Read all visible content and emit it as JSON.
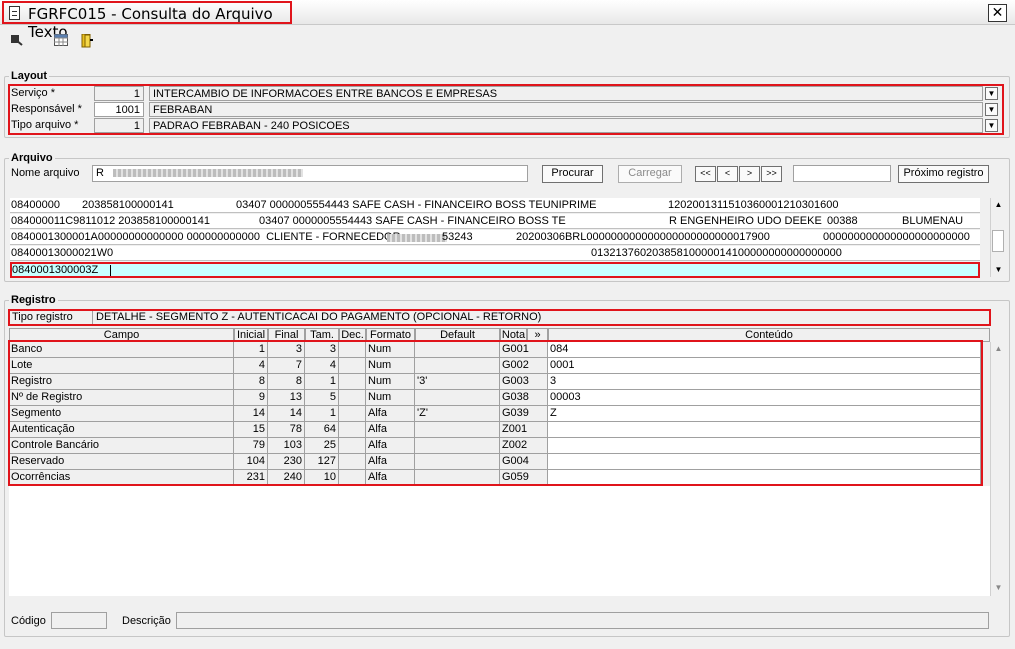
{
  "window": {
    "title": "FGRFC015 - Consulta do Arquivo Texto",
    "close_label": "✕"
  },
  "layout": {
    "title": "Layout",
    "servico": {
      "label": "Serviço *",
      "code": "1",
      "value": "INTERCAMBIO DE INFORMACOES ENTRE BANCOS E EMPRESAS"
    },
    "responsavel": {
      "label": "Responsável *",
      "code": "1001",
      "value": "FEBRABAN"
    },
    "tipo_arquivo": {
      "label": "Tipo arquivo *",
      "code": "1",
      "value": "PADRAO FEBRABAN - 240 POSICOES"
    }
  },
  "arquivo": {
    "title": "Arquivo",
    "nome_label": "Nome arquivo",
    "nome_value": "R",
    "buttons": {
      "procurar": "Procurar",
      "carregar": "Carregar",
      "first": "<<",
      "prev": "<",
      "next": ">",
      "last": ">>",
      "proximo": "Próximo registro"
    },
    "search_value": "",
    "lines": [
      [
        "08400000",
        "203858100000141",
        "03407 0000005554443 SAFE CASH - FINANCEIRO BOSS TEUNIPRIME",
        "1202001311510360001210301600"
      ],
      [
        "084000011C9811012 203858100000141",
        "03407 0000005554443 SAFE CASH - FINANCEIRO BOSS TE",
        "R ENGENHEIRO UDO DEEKE",
        "00388",
        "BLUMENAU"
      ],
      [
        "0840001300001A00000000000000 000000000000  CLIENTE - FORNECEDOR",
        "53243",
        "20200306BRL000000000000000000000000017900",
        "000000000000000000000000"
      ],
      [
        "08400013000021W0",
        "01321376020385810000014100000000000000000"
      ],
      [
        "0840001300003Z"
      ]
    ]
  },
  "registro": {
    "title": "Registro",
    "tipo_label": "Tipo registro",
    "tipo_value": "DETALHE - SEGMENTO Z - AUTENTICACAI DO PAGAMENTO (OPCIONAL - RETORNO)",
    "columns": [
      "Campo",
      "Inicial",
      "Final",
      "Tam.",
      "Dec.",
      "Formato",
      "Default",
      "Nota",
      "»",
      "Conteúdo"
    ],
    "rows": [
      [
        "Banco",
        "1",
        "3",
        "3",
        "",
        "Num",
        "",
        "G001",
        "084"
      ],
      [
        "Lote",
        "4",
        "7",
        "4",
        "",
        "Num",
        "",
        "G002",
        "0001"
      ],
      [
        "Registro",
        "8",
        "8",
        "1",
        "",
        "Num",
        "'3'",
        "G003",
        "3"
      ],
      [
        "Nº de Registro",
        "9",
        "13",
        "5",
        "",
        "Num",
        "",
        "G038",
        "00003"
      ],
      [
        "Segmento",
        "14",
        "14",
        "1",
        "",
        "Alfa",
        "'Z'",
        "G039",
        "Z"
      ],
      [
        "Autenticação",
        "15",
        "78",
        "64",
        "",
        "Alfa",
        "",
        "Z001",
        ""
      ],
      [
        "Controle Bancário",
        "79",
        "103",
        "25",
        "",
        "Alfa",
        "",
        "Z002",
        ""
      ],
      [
        "Reservado",
        "104",
        "230",
        "127",
        "",
        "Alfa",
        "",
        "G004",
        ""
      ],
      [
        "Ocorrências",
        "231",
        "240",
        "10",
        "",
        "Alfa",
        "",
        "G059",
        ""
      ]
    ]
  },
  "footer": {
    "codigo_label": "Código",
    "descricao_label": "Descrição"
  },
  "colors": {
    "accent_red": "#e0141b",
    "selected_row": "#c8ffff"
  }
}
